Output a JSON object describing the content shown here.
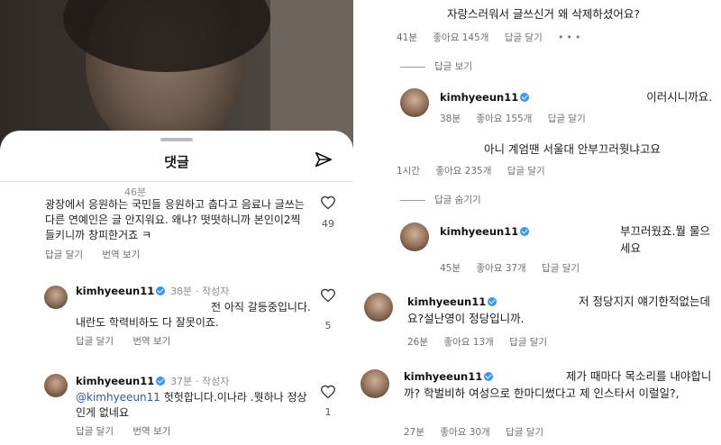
{
  "left": {
    "sheet_title": "댓글",
    "comments": [
      {
        "time": "46분",
        "text": "광장에서 응원하는 국민들 응원하고 춥다고 음료나 글쓰는 다른 연예인은 글 안지워요. 왜냐? 떳떳하니까 본인이2찍 들키니까 창피한거죠 ㅋ",
        "reply": "답글 달기",
        "translate": "번역 보기",
        "likes": "49"
      },
      {
        "username": "kimhyeeun11",
        "time": "38분",
        "author_tag": "작성자",
        "text": "전 아직 갈등중입니다. 내란도 학력비하도 다 잘못이죠.",
        "reply": "답글 달기",
        "translate": "번역 보기",
        "likes": "5"
      },
      {
        "username": "kimhyeeun11",
        "time": "37분",
        "author_tag": "작성자",
        "mention": "@kimhyeeun11",
        "text": "헛헛합니다.이나라 .뭣하나 정상인게 없네요",
        "reply": "답글 달기",
        "translate": "번역 보기",
        "likes": "1"
      }
    ]
  },
  "right": {
    "c1": {
      "text": "자랑스러워서 글쓰신거 왜 삭제하셨어요?",
      "time": "41분",
      "likes": "좋아요 145개",
      "reply": "답글 달기",
      "more": "• • •"
    },
    "view_replies": "답글 보기",
    "c2": {
      "username": "kimhyeeun11",
      "text": "이러시니까요.",
      "time": "38분",
      "likes": "좋아요 155개",
      "reply": "답글 달기"
    },
    "c3": {
      "text": "아니 계엄땐 서울대 안부끄러웟냐고요",
      "time": "1시간",
      "likes": "좋아요 235개",
      "reply": "답글 달기"
    },
    "hide_replies": "답글 숨기기",
    "c4": {
      "username": "kimhyeeun11",
      "text": "부끄러웠죠.뭘 물으세요",
      "time": "45분",
      "likes": "좋아요 37개",
      "reply": "답글 달기"
    },
    "c5": {
      "username": "kimhyeeun11",
      "text": "저 정당지지 얘기한적없는데요?설난영이 정당입니까.",
      "time": "26분",
      "likes": "좋아요 13개",
      "reply": "답글 달기"
    },
    "c6": {
      "username": "kimhyeeun11",
      "text": "제가 때마다 목소리를 내야합니까? 학벌비하 여성으로 한마디썼다고 제 인스타서 이럴일?,",
      "time": "27분",
      "likes": "좋아요 30개",
      "reply": "답글 달기"
    }
  }
}
